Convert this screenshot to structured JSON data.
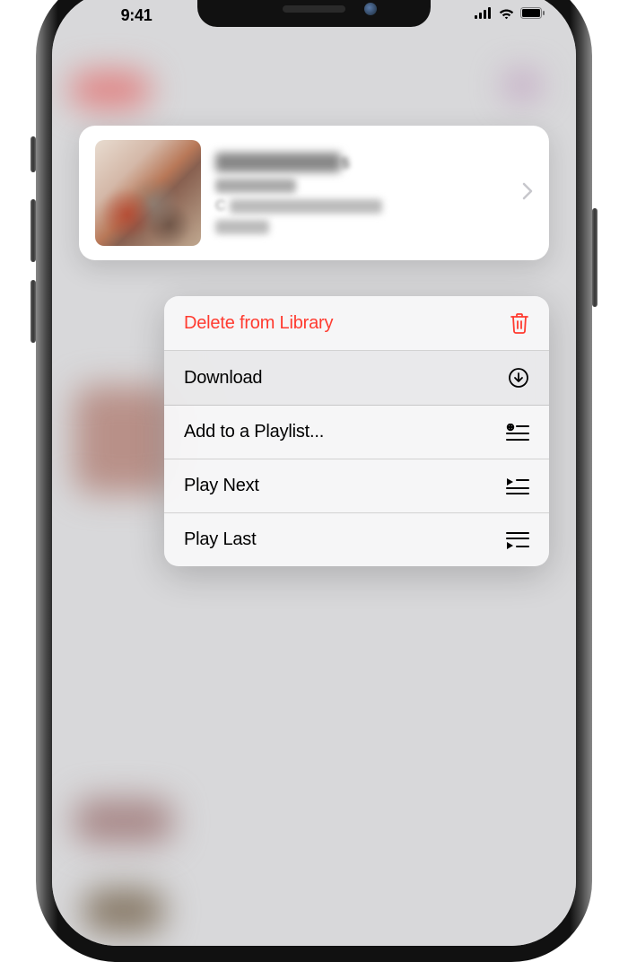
{
  "status": {
    "time": "9:41"
  },
  "card": {
    "title_visible_suffix": "s"
  },
  "menu": {
    "delete": "Delete from Library",
    "download": "Download",
    "add_playlist": "Add to a Playlist...",
    "play_next": "Play Next",
    "play_last": "Play Last"
  }
}
